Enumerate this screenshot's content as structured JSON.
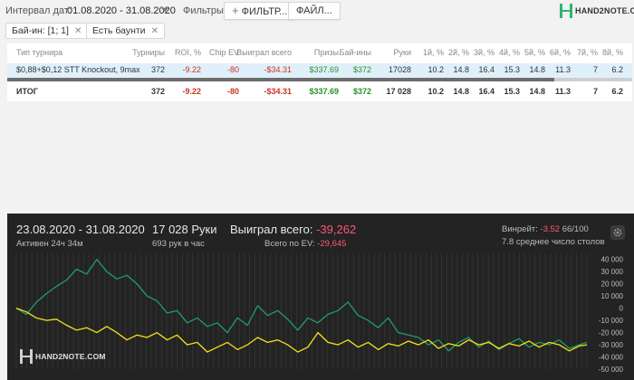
{
  "toolbar": {
    "date_label": "Интервал дат:",
    "date_value": "01.08.2020 - 31.08.2020",
    "filters_label": "Фильтры:",
    "filter_button": "ФИЛЬТР...",
    "file_button": "ФАЙЛ..."
  },
  "logo": {
    "text": "HAND2NOTE.COM"
  },
  "chips": [
    {
      "label": "Бай-ин: [1; 1]"
    },
    {
      "label": "Есть баунти"
    }
  ],
  "table": {
    "columns": [
      "Тип турнира",
      "Турниры",
      "ROI, %",
      "Chip EV",
      "Выиграл всего",
      "Призы",
      "Бай-ины",
      "Руки",
      "1й, %",
      "2й, %",
      "3й, %",
      "4й, %",
      "5й, %",
      "6й, %",
      "7й, %",
      "8й, %"
    ],
    "row": [
      "$0,88+$0,12 STT Knockout, 9max",
      "372",
      "-9.22",
      "-80",
      "-$34.31",
      "$337.69",
      "$372",
      "17028",
      "10.2",
      "14.8",
      "16.4",
      "15.3",
      "14.8",
      "11.3",
      "7",
      "6.2"
    ],
    "total": [
      "ИТОГ",
      "372",
      "-9.22",
      "-80",
      "-$34.31",
      "$337.69",
      "$372",
      "17 028",
      "10.2",
      "14.8",
      "16.4",
      "15.3",
      "14.8",
      "11.3",
      "7",
      "6.2"
    ]
  },
  "stats": {
    "date_range": "23.08.2020 - 31.08.2020",
    "active": "Активен 24ч 34м",
    "hands": "17 028 Руки",
    "hands_per_hour": "693 рук в час",
    "won_label": "Выиграл всего:",
    "won_value": "-39,262",
    "ev_label": "Всего по EV:",
    "ev_value": "-29,645",
    "winrate_label": "Винрейт:",
    "winrate_value": "-3.52",
    "winrate_count": "66/100",
    "avg_tables": "7.8 среднее число столов"
  },
  "chart_data": {
    "type": "line",
    "yticks": [
      "40 000",
      "30 000",
      "20 000",
      "10 000",
      "0",
      "-10 000",
      "-20 000",
      "-30 000",
      "-40 000",
      "-50 000"
    ],
    "ylim": [
      -50000,
      45000
    ],
    "x_range": [
      0,
      17028
    ],
    "series": [
      {
        "color": "#1f9d6a",
        "points": [
          [
            0,
            0
          ],
          [
            300,
            -5000
          ],
          [
            600,
            5000
          ],
          [
            900,
            12000
          ],
          [
            1200,
            18000
          ],
          [
            1500,
            23000
          ],
          [
            1800,
            32000
          ],
          [
            2100,
            28000
          ],
          [
            2400,
            40000
          ],
          [
            2700,
            30000
          ],
          [
            3000,
            24000
          ],
          [
            3300,
            27000
          ],
          [
            3600,
            20000
          ],
          [
            3900,
            10000
          ],
          [
            4200,
            6000
          ],
          [
            4500,
            -4000
          ],
          [
            4800,
            -2000
          ],
          [
            5100,
            -12000
          ],
          [
            5400,
            -8000
          ],
          [
            5700,
            -15000
          ],
          [
            6000,
            -12000
          ],
          [
            6300,
            -20000
          ],
          [
            6600,
            -8000
          ],
          [
            6900,
            -14000
          ],
          [
            7200,
            2000
          ],
          [
            7500,
            -6000
          ],
          [
            7800,
            -2000
          ],
          [
            8100,
            -9000
          ],
          [
            8400,
            -18000
          ],
          [
            8700,
            -8000
          ],
          [
            9000,
            -12000
          ],
          [
            9300,
            -5000
          ],
          [
            9600,
            -2000
          ],
          [
            9900,
            5000
          ],
          [
            10200,
            -6000
          ],
          [
            10500,
            -10000
          ],
          [
            10800,
            -16000
          ],
          [
            11100,
            -8000
          ],
          [
            11400,
            -20000
          ],
          [
            11700,
            -22000
          ],
          [
            12000,
            -24000
          ],
          [
            12300,
            -30000
          ],
          [
            12600,
            -26000
          ],
          [
            12900,
            -35000
          ],
          [
            13200,
            -28000
          ],
          [
            13500,
            -24000
          ],
          [
            13800,
            -32000
          ],
          [
            14100,
            -27000
          ],
          [
            14400,
            -34000
          ],
          [
            14700,
            -29000
          ],
          [
            15000,
            -25000
          ],
          [
            15300,
            -32000
          ],
          [
            15600,
            -28000
          ],
          [
            15900,
            -30000
          ],
          [
            16200,
            -26000
          ],
          [
            16500,
            -33000
          ],
          [
            16800,
            -30000
          ],
          [
            17028,
            -28000
          ]
        ]
      },
      {
        "color": "#f4e21b",
        "points": [
          [
            0,
            0
          ],
          [
            300,
            -3000
          ],
          [
            600,
            -8000
          ],
          [
            900,
            -10000
          ],
          [
            1200,
            -9000
          ],
          [
            1500,
            -14000
          ],
          [
            1800,
            -18000
          ],
          [
            2100,
            -16000
          ],
          [
            2400,
            -20000
          ],
          [
            2700,
            -15000
          ],
          [
            3000,
            -20000
          ],
          [
            3300,
            -26000
          ],
          [
            3600,
            -22000
          ],
          [
            3900,
            -24000
          ],
          [
            4200,
            -20000
          ],
          [
            4500,
            -26000
          ],
          [
            4800,
            -22000
          ],
          [
            5100,
            -30000
          ],
          [
            5400,
            -28000
          ],
          [
            5700,
            -36000
          ],
          [
            6000,
            -32000
          ],
          [
            6300,
            -28000
          ],
          [
            6600,
            -34000
          ],
          [
            6900,
            -30000
          ],
          [
            7200,
            -24000
          ],
          [
            7500,
            -28000
          ],
          [
            7800,
            -26000
          ],
          [
            8100,
            -30000
          ],
          [
            8400,
            -36000
          ],
          [
            8700,
            -32000
          ],
          [
            9000,
            -20000
          ],
          [
            9300,
            -28000
          ],
          [
            9600,
            -30000
          ],
          [
            9900,
            -26000
          ],
          [
            10200,
            -32000
          ],
          [
            10500,
            -28000
          ],
          [
            10800,
            -34000
          ],
          [
            11100,
            -29000
          ],
          [
            11400,
            -31000
          ],
          [
            11700,
            -27000
          ],
          [
            12000,
            -30000
          ],
          [
            12300,
            -26000
          ],
          [
            12600,
            -33000
          ],
          [
            12900,
            -29000
          ],
          [
            13200,
            -31000
          ],
          [
            13500,
            -26000
          ],
          [
            13800,
            -30000
          ],
          [
            14100,
            -28000
          ],
          [
            14400,
            -33000
          ],
          [
            14700,
            -29000
          ],
          [
            15000,
            -31000
          ],
          [
            15300,
            -27000
          ],
          [
            15600,
            -32000
          ],
          [
            15900,
            -28000
          ],
          [
            16200,
            -30000
          ],
          [
            16500,
            -35000
          ],
          [
            16800,
            -31000
          ],
          [
            17028,
            -30000
          ]
        ]
      }
    ]
  }
}
